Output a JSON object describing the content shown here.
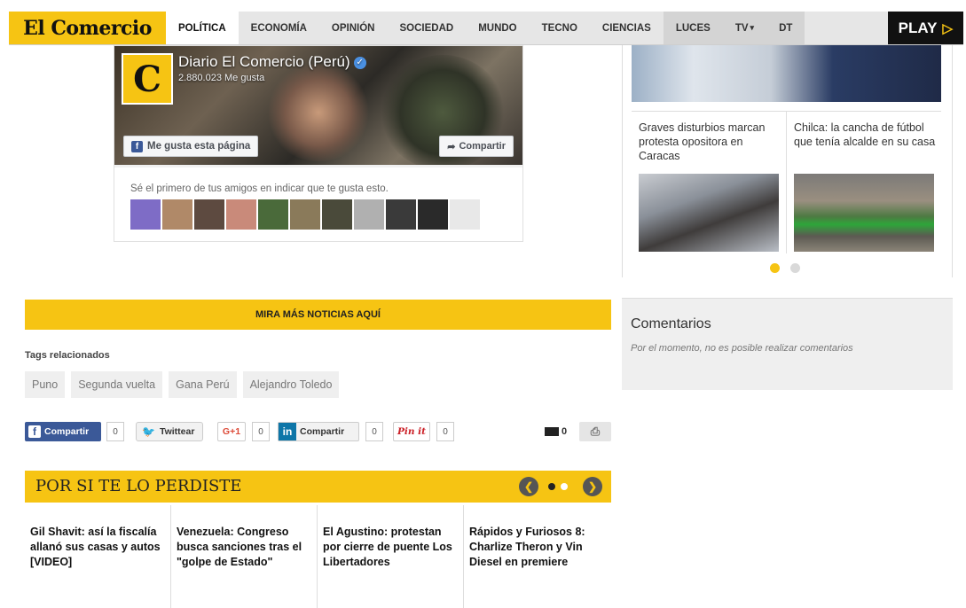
{
  "nav": {
    "logo": "El Comercio",
    "items": [
      "POLÍTICA",
      "ECONOMÍA",
      "OPINIÓN",
      "SOCIEDAD",
      "MUNDO",
      "TECNO",
      "CIENCIAS",
      "LUCES",
      "TV",
      "DT"
    ],
    "play": "PLAY",
    "accent": "#f6c413"
  },
  "facebook": {
    "page_name": "Diario El Comercio (Perú)",
    "likes": "2.880.023 Me gusta",
    "like_button": "Me gusta esta página",
    "share_button": "Compartir",
    "friends_text": "Sé el primero de tus amigos en indicar que te gusta esto.",
    "avatar_letter": "C",
    "faces": [
      "#7e6cc6",
      "#b08968",
      "#5d4a40",
      "#c98a7a",
      "#4a6a3a",
      "#8a7a5a",
      "#4a4a3a",
      "#b0b0b0",
      "#3a3a3a",
      "#2a2a2a",
      "#e8e8e8"
    ]
  },
  "gallery": {
    "items": [
      {
        "title": "Graves disturbios marcan protesta opositora en Caracas"
      },
      {
        "title": "Chilca: la cancha de fútbol que tenía alcalde en su casa"
      }
    ]
  },
  "mira_mas": "MIRA MÁS NOTICIAS AQUÍ",
  "comentarios": {
    "title": "Comentarios",
    "text": "Por el momento, no es posible realizar comentarios"
  },
  "tags": {
    "label": "Tags relacionados",
    "items": [
      "Puno",
      "Segunda vuelta",
      "Gana Perú",
      "Alejandro Toledo"
    ]
  },
  "social": {
    "facebook": "Compartir",
    "facebook_count": "0",
    "twitter": "Twittear",
    "gplus": "G+1",
    "gplus_count": "0",
    "linkedin": "Compartir",
    "linkedin_count": "0",
    "pinterest": "Pin it",
    "pinterest_count": "0",
    "comments_count": "0"
  },
  "perdiste": {
    "title": "POR SI TE LO PERDISTE",
    "items": [
      "Gil Shavit: así la fiscalía allanó sus casas y autos [VIDEO]",
      "Venezuela: Congreso busca sanciones tras el \"golpe de Estado\"",
      "El Agustino: protestan por cierre de puente Los Libertadores",
      "Rápidos y Furiosos 8: Charlize Theron y Vin Diesel en premiere"
    ]
  }
}
